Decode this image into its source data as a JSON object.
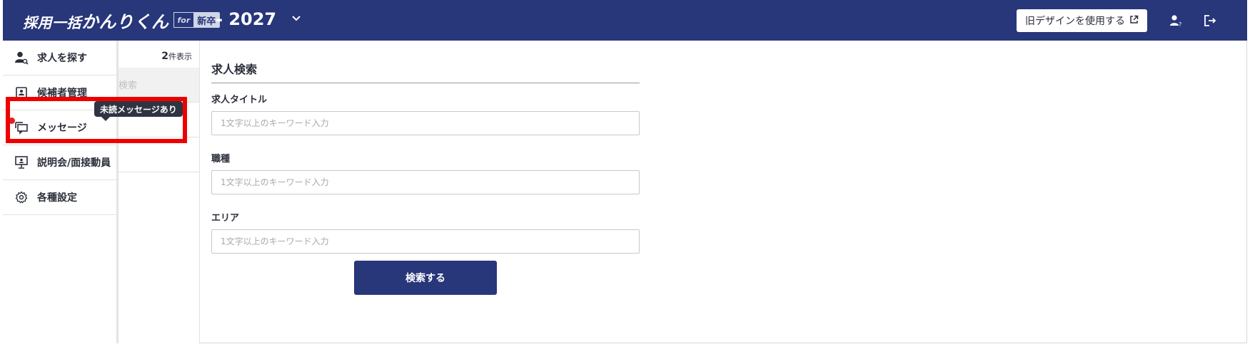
{
  "header": {
    "logo_main": "採用一括",
    "logo_kana": "かんりくん",
    "logo_for": "for",
    "logo_badge": "新卒",
    "year": "- 2027",
    "old_design_label": "旧デザインを使用する",
    "background": "#28367a"
  },
  "sidebar": {
    "items": [
      {
        "label": "求人を探す",
        "icon": "person-search-icon"
      },
      {
        "label": "候補者管理",
        "icon": "id-card-icon"
      },
      {
        "label": "メッセージ",
        "icon": "chat-bubbles-icon"
      },
      {
        "label": "説明会/面接動員",
        "icon": "presentation-screen-icon"
      },
      {
        "label": "各種設定",
        "icon": "gear-icon"
      }
    ]
  },
  "tooltip": {
    "text": "未読メッセージあり"
  },
  "list_panel": {
    "count_number": "2",
    "count_suffix": "件表示",
    "obscured_text": "検索"
  },
  "search_form": {
    "title": "求人検索",
    "fields": [
      {
        "label": "求人タイトル",
        "placeholder": "1文字以上のキーワード入力",
        "value": ""
      },
      {
        "label": "職種",
        "placeholder": "1文字以上のキーワード入力",
        "value": ""
      },
      {
        "label": "エリア",
        "placeholder": "1文字以上のキーワード入力",
        "value": ""
      }
    ],
    "submit_label": "検索する"
  },
  "colors": {
    "brand": "#28367a",
    "highlight": "#ee0000",
    "unread_dot": "#e02020"
  }
}
